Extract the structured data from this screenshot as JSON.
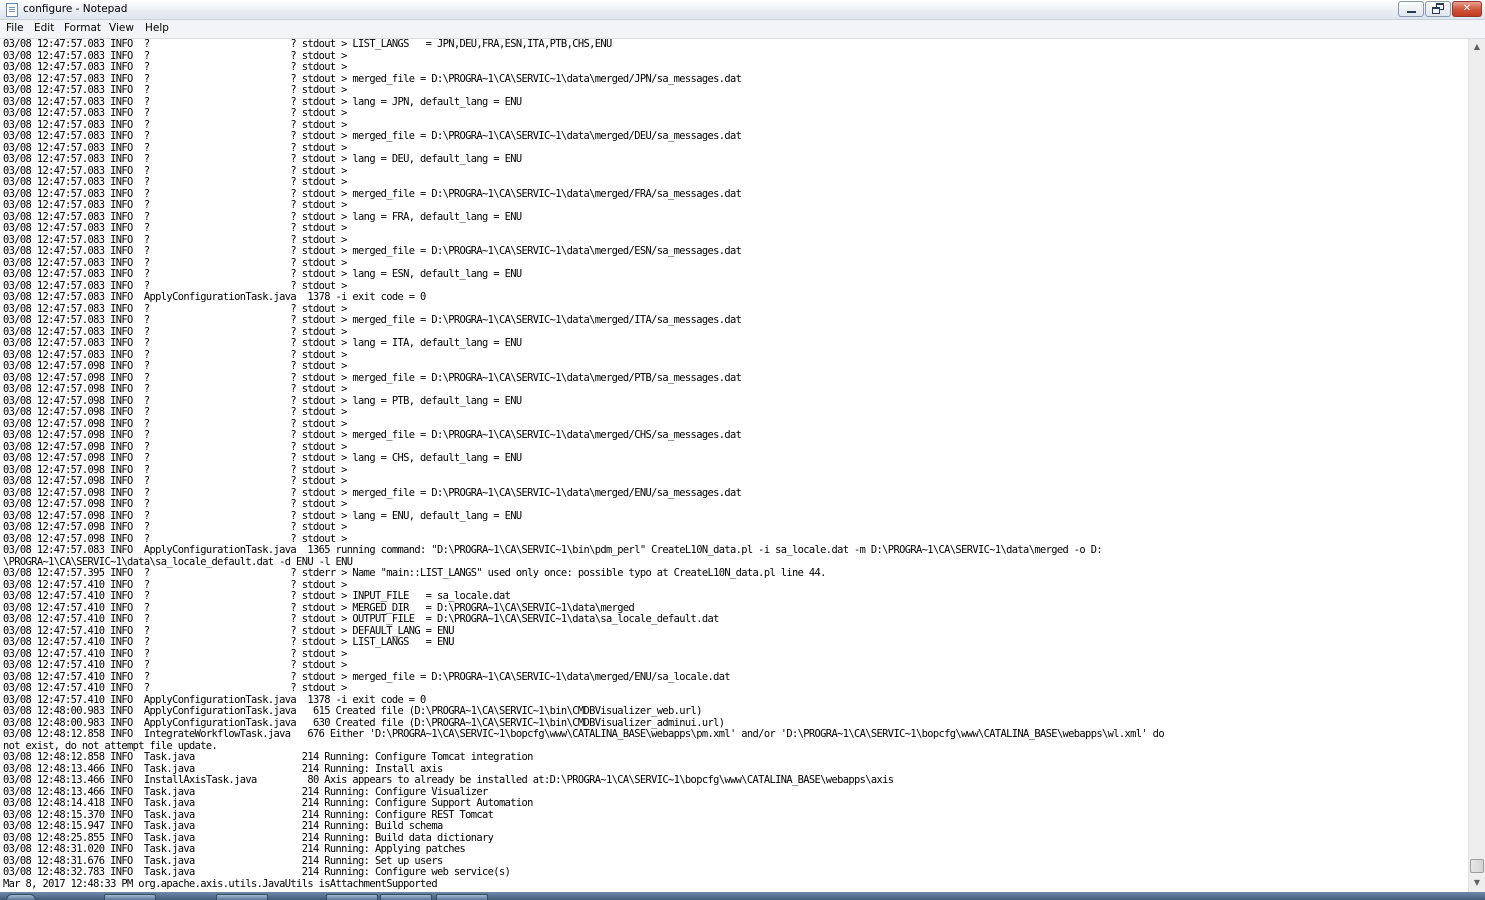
{
  "window": {
    "title": "configure - Notepad",
    "controls": {
      "minimize": "minimize",
      "maximize": "restore",
      "close": "close"
    }
  },
  "menu": [
    {
      "label": "File"
    },
    {
      "label": "Edit"
    },
    {
      "label": "Format"
    },
    {
      "label": "View"
    },
    {
      "label": "Help"
    }
  ],
  "lines": [
    "03/08 12:47:57.083 INFO  ?                         ? stdout > LIST_LANGS   = JPN,DEU,FRA,ESN,ITA,PTB,CHS,ENU",
    "03/08 12:47:57.083 INFO  ?                         ? stdout >",
    "03/08 12:47:57.083 INFO  ?                         ? stdout >",
    "03/08 12:47:57.083 INFO  ?                         ? stdout > merged_file = D:\\PROGRA~1\\CA\\SERVIC~1\\data\\merged/JPN/sa_messages.dat",
    "03/08 12:47:57.083 INFO  ?                         ? stdout >",
    "03/08 12:47:57.083 INFO  ?                         ? stdout > lang = JPN, default_lang = ENU",
    "03/08 12:47:57.083 INFO  ?                         ? stdout >",
    "03/08 12:47:57.083 INFO  ?                         ? stdout >",
    "03/08 12:47:57.083 INFO  ?                         ? stdout > merged_file = D:\\PROGRA~1\\CA\\SERVIC~1\\data\\merged/DEU/sa_messages.dat",
    "03/08 12:47:57.083 INFO  ?                         ? stdout >",
    "03/08 12:47:57.083 INFO  ?                         ? stdout > lang = DEU, default_lang = ENU",
    "03/08 12:47:57.083 INFO  ?                         ? stdout >",
    "03/08 12:47:57.083 INFO  ?                         ? stdout >",
    "03/08 12:47:57.083 INFO  ?                         ? stdout > merged_file = D:\\PROGRA~1\\CA\\SERVIC~1\\data\\merged/FRA/sa_messages.dat",
    "03/08 12:47:57.083 INFO  ?                         ? stdout >",
    "03/08 12:47:57.083 INFO  ?                         ? stdout > lang = FRA, default_lang = ENU",
    "03/08 12:47:57.083 INFO  ?                         ? stdout >",
    "03/08 12:47:57.083 INFO  ?                         ? stdout >",
    "03/08 12:47:57.083 INFO  ?                         ? stdout > merged_file = D:\\PROGRA~1\\CA\\SERVIC~1\\data\\merged/ESN/sa_messages.dat",
    "03/08 12:47:57.083 INFO  ?                         ? stdout >",
    "03/08 12:47:57.083 INFO  ?                         ? stdout > lang = ESN, default_lang = ENU",
    "03/08 12:47:57.083 INFO  ?                         ? stdout >",
    "03/08 12:47:57.083 INFO  ApplyConfigurationTask.java  1378 -i exit code = 0",
    "03/08 12:47:57.083 INFO  ?                         ? stdout >",
    "03/08 12:47:57.083 INFO  ?                         ? stdout > merged_file = D:\\PROGRA~1\\CA\\SERVIC~1\\data\\merged/ITA/sa_messages.dat",
    "03/08 12:47:57.083 INFO  ?                         ? stdout >",
    "03/08 12:47:57.083 INFO  ?                         ? stdout > lang = ITA, default_lang = ENU",
    "03/08 12:47:57.083 INFO  ?                         ? stdout >",
    "03/08 12:47:57.098 INFO  ?                         ? stdout >",
    "03/08 12:47:57.098 INFO  ?                         ? stdout > merged_file = D:\\PROGRA~1\\CA\\SERVIC~1\\data\\merged/PTB/sa_messages.dat",
    "03/08 12:47:57.098 INFO  ?                         ? stdout >",
    "03/08 12:47:57.098 INFO  ?                         ? stdout > lang = PTB, default_lang = ENU",
    "03/08 12:47:57.098 INFO  ?                         ? stdout >",
    "03/08 12:47:57.098 INFO  ?                         ? stdout >",
    "03/08 12:47:57.098 INFO  ?                         ? stdout > merged_file = D:\\PROGRA~1\\CA\\SERVIC~1\\data\\merged/CHS/sa_messages.dat",
    "03/08 12:47:57.098 INFO  ?                         ? stdout >",
    "03/08 12:47:57.098 INFO  ?                         ? stdout > lang = CHS, default_lang = ENU",
    "03/08 12:47:57.098 INFO  ?                         ? stdout >",
    "03/08 12:47:57.098 INFO  ?                         ? stdout >",
    "03/08 12:47:57.098 INFO  ?                         ? stdout > merged_file = D:\\PROGRA~1\\CA\\SERVIC~1\\data\\merged/ENU/sa_messages.dat",
    "03/08 12:47:57.098 INFO  ?                         ? stdout >",
    "03/08 12:47:57.098 INFO  ?                         ? stdout > lang = ENU, default_lang = ENU",
    "03/08 12:47:57.098 INFO  ?                         ? stdout >",
    "03/08 12:47:57.098 INFO  ?                         ? stdout >",
    "03/08 12:47:57.083 INFO  ApplyConfigurationTask.java  1365 running command: \"D:\\PROGRA~1\\CA\\SERVIC~1\\bin\\pdm_perl\" CreateL10N_data.pl -i sa_locale.dat -m D:\\PROGRA~1\\CA\\SERVIC~1\\data\\merged -o D:",
    "\\PROGRA~1\\CA\\SERVIC~1\\data\\sa_locale_default.dat -d ENU -l ENU",
    "03/08 12:47:57.395 INFO  ?                         ? stderr > Name \"main::LIST_LANGS\" used only once: possible typo at CreateL10N_data.pl line 44.",
    "03/08 12:47:57.410 INFO  ?                         ? stdout >",
    "03/08 12:47:57.410 INFO  ?                         ? stdout > INPUT_FILE   = sa_locale.dat",
    "03/08 12:47:57.410 INFO  ?                         ? stdout > MERGED_DIR   = D:\\PROGRA~1\\CA\\SERVIC~1\\data\\merged",
    "03/08 12:47:57.410 INFO  ?                         ? stdout > OUTPUT_FILE  = D:\\PROGRA~1\\CA\\SERVIC~1\\data\\sa_locale_default.dat",
    "03/08 12:47:57.410 INFO  ?                         ? stdout > DEFAULT_LANG = ENU",
    "03/08 12:47:57.410 INFO  ?                         ? stdout > LIST_LANGS   = ENU",
    "03/08 12:47:57.410 INFO  ?                         ? stdout >",
    "03/08 12:47:57.410 INFO  ?                         ? stdout >",
    "03/08 12:47:57.410 INFO  ?                         ? stdout > merged_file = D:\\PROGRA~1\\CA\\SERVIC~1\\data\\merged/ENU/sa_locale.dat",
    "03/08 12:47:57.410 INFO  ?                         ? stdout >",
    "03/08 12:47:57.410 INFO  ApplyConfigurationTask.java  1378 -i exit code = 0",
    "03/08 12:48:00.983 INFO  ApplyConfigurationTask.java   615 Created file (D:\\PROGRA~1\\CA\\SERVIC~1\\bin\\CMDBVisualizer_web.url)",
    "03/08 12:48:00.983 INFO  ApplyConfigurationTask.java   630 Created file (D:\\PROGRA~1\\CA\\SERVIC~1\\bin\\CMDBVisualizer_adminui.url)",
    "03/08 12:48:12.858 INFO  IntegrateWorkflowTask.java   676 Either 'D:\\PROGRA~1\\CA\\SERVIC~1\\bopcfg\\www\\CATALINA_BASE\\webapps\\pm.xml' and/or 'D:\\PROGRA~1\\CA\\SERVIC~1\\bopcfg\\www\\CATALINA_BASE\\webapps\\wl.xml' do",
    "not exist, do not attempt file update.",
    "03/08 12:48:12.858 INFO  Task.java                   214 Running: Configure Tomcat integration",
    "03/08 12:48:13.466 INFO  Task.java                   214 Running: Install axis",
    "03/08 12:48:13.466 INFO  InstallAxisTask.java         80 Axis appears to already be installed at:D:\\PROGRA~1\\CA\\SERVIC~1\\bopcfg\\www\\CATALINA_BASE\\webapps\\axis",
    "03/08 12:48:13.466 INFO  Task.java                   214 Running: Configure Visualizer",
    "03/08 12:48:14.418 INFO  Task.java                   214 Running: Configure Support Automation",
    "03/08 12:48:15.370 INFO  Task.java                   214 Running: Configure REST Tomcat",
    "03/08 12:48:15.947 INFO  Task.java                   214 Running: Build schema",
    "03/08 12:48:25.855 INFO  Task.java                   214 Running: Build data dictionary",
    "03/08 12:48:31.020 INFO  Task.java                   214 Running: Applying patches",
    "03/08 12:48:31.676 INFO  Task.java                   214 Running: Set up users",
    "03/08 12:48:32.783 INFO  Task.java                   214 Running: Configure web service(s)",
    "Mar 8, 2017 12:48:33 PM org.apache.axis.utils.JavaUtils isAttachmentSupported"
  ],
  "colors": {
    "titlebar": "#dfe5ee",
    "close_button": "#c23a22",
    "text": "#000000",
    "background": "#ffffff"
  }
}
